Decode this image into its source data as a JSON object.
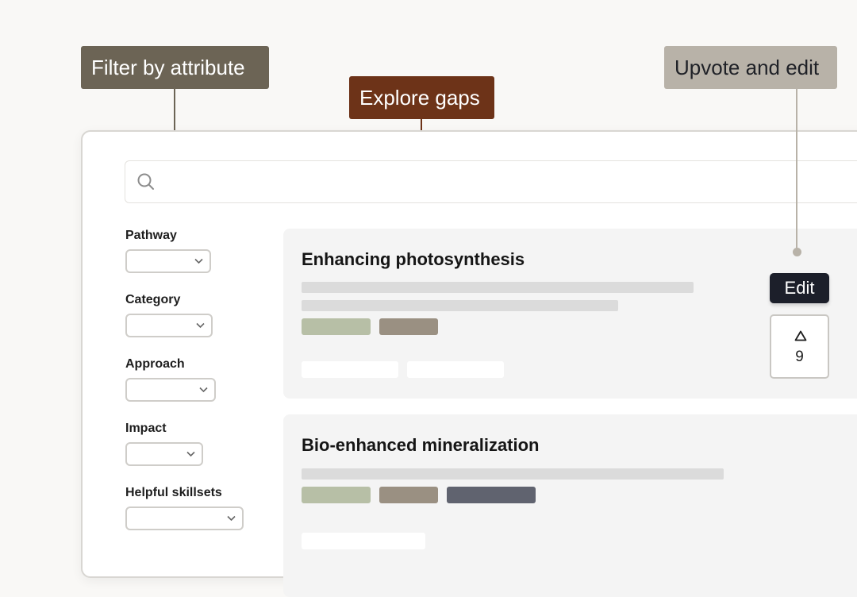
{
  "callouts": {
    "filter": "Filter by attribute",
    "gaps": "Explore gaps",
    "upvote": "Upvote and edit"
  },
  "colors": {
    "filter_callout": "#6c6455",
    "gaps_callout": "#6d3318",
    "upvote_callout": "#b8b2a8",
    "edit_button": "#1c1f2a",
    "tag_sage": "#b7bfa6",
    "tag_taupe": "#9a9082",
    "tag_slate": "#60636f"
  },
  "search": {
    "icon": "search-icon",
    "placeholder": ""
  },
  "filters": [
    {
      "label": "Pathway",
      "value": ""
    },
    {
      "label": "Category",
      "value": ""
    },
    {
      "label": "Approach",
      "value": ""
    },
    {
      "label": "Impact",
      "value": ""
    },
    {
      "label": "Helpful skillsets",
      "value": ""
    }
  ],
  "cards": [
    {
      "title": "Enhancing photosynthesis",
      "edit_label": "Edit",
      "vote_icon": "upvote-triangle-icon",
      "votes": "9"
    },
    {
      "title": "Bio-enhanced mineralization"
    }
  ]
}
